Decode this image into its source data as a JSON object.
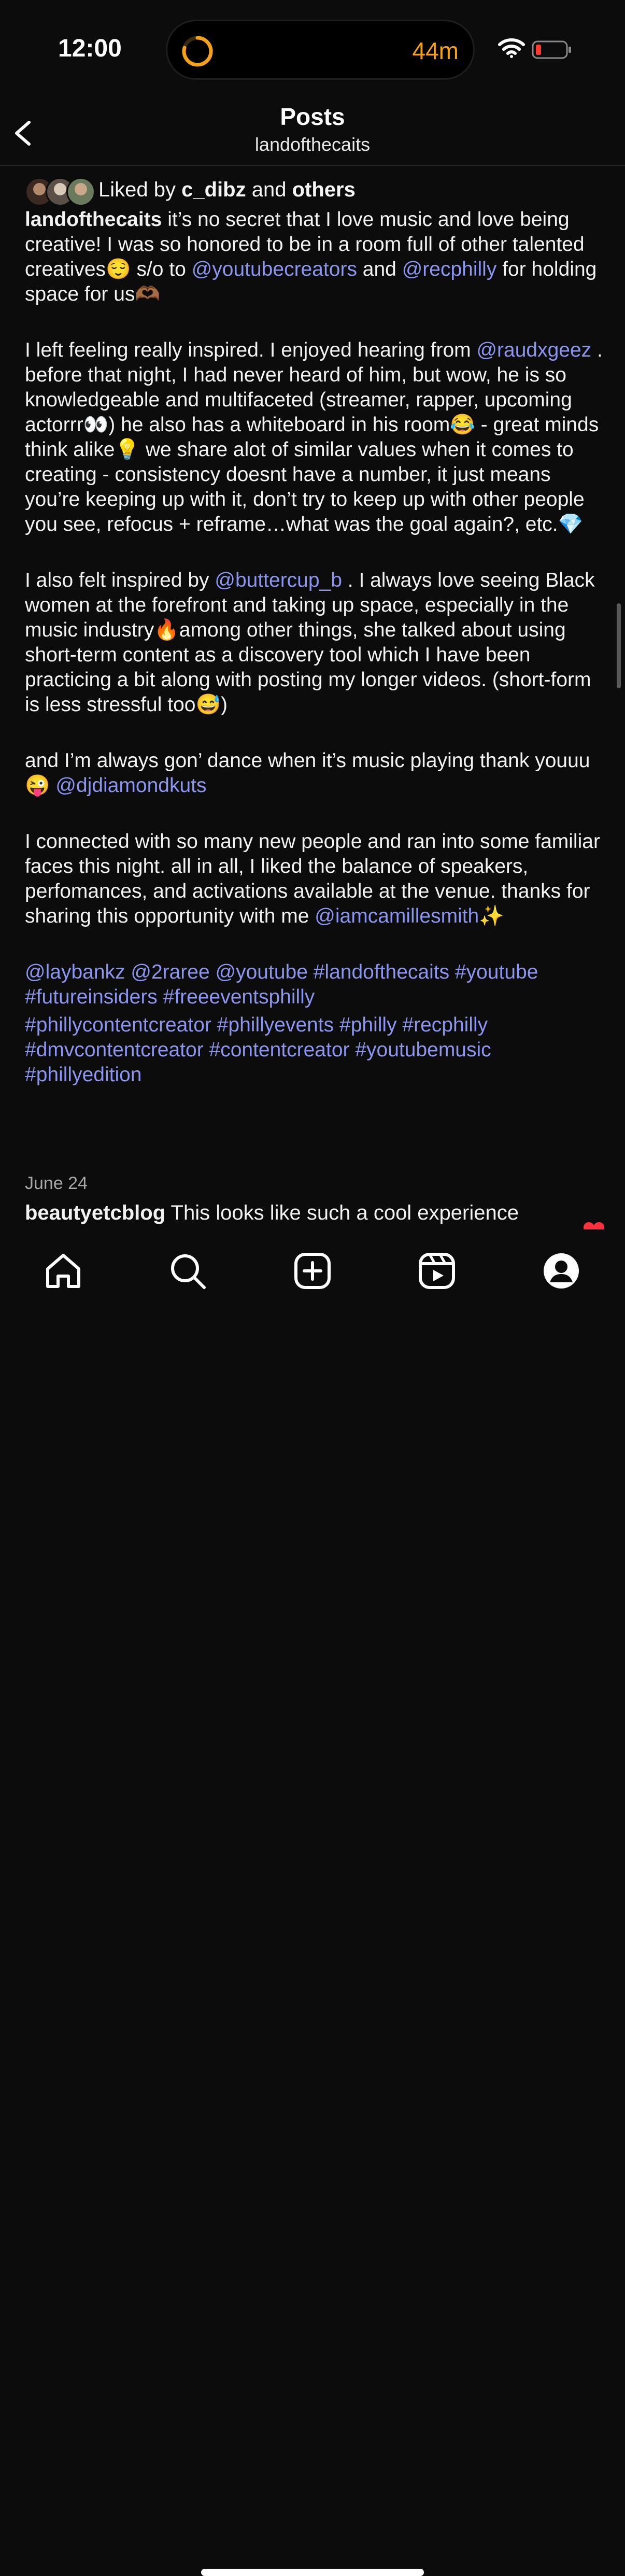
{
  "status_bar": {
    "time": "12:00",
    "timer": "44m",
    "timer_color": "#f5a11c"
  },
  "header": {
    "title": "Posts",
    "subtitle": "landofthecaits"
  },
  "likes": {
    "prefix": "Liked by ",
    "user": "c_dibz",
    "middle": " and ",
    "others": "others"
  },
  "post": {
    "username": "landofthecaits",
    "p1": {
      "text_a": " it’s no secret that I love music and love being creative! I was so honored to be in a room full of other talented creatives😌 s/o to ",
      "mention_a": "@youtubecreators",
      "text_b": " and ",
      "mention_b": "@recphilly",
      "text_c": " for holding space for us🫶🏾"
    },
    "p2": {
      "text_a": "I left feeling really inspired. I enjoyed hearing from ",
      "mention_a": "@raudxgeez",
      "text_b": " . before that night, I had never heard of him, but wow, he is so knowledgeable and multifaceted (streamer, rapper, upcoming actorrr👀) he also has a whiteboard in his room😂 - great minds think alike💡 we share alot of similar values when it comes to creating - consistency doesnt have a number, it just means you’re keeping up with it, don’t try to keep up with other people you see, refocus + reframe…what was the goal again?, etc.💎"
    },
    "p3": {
      "text_a": "I also felt inspired by ",
      "mention_a": "@buttercup_b",
      "text_b": " . I always love seeing Black women at the forefront and taking up space, especially in the music industry🔥among other things, she talked about using short-term content as a discovery tool which I have been practicing a bit along with posting my longer videos. (short-form is less stressful too😅)"
    },
    "p4": {
      "text_a": "and I’m always gon’ dance when it’s music playing thank youuu😜 ",
      "mention_a": "@djdiamondkuts"
    },
    "p5": {
      "text_a": "I connected with so many new people and ran into some familiar faces this night. all in all, I liked the balance of speakers, perfomances, and activations available at the venue. thanks for sharing this opportunity with me ",
      "mention_a": "@iamcamillesmith",
      "text_b": "✨"
    },
    "tags_line1": "@laybankz @2raree @youtube #landofthecaits #youtube #futureinsiders #freeeventsphilly",
    "tags_line2": "#phillycontentcreator #phillyevents #philly #recphilly #dmvcontentcreator #contentcreator #youtubemusic #phillyedition",
    "date": "June 24"
  },
  "comment": {
    "username": "beautyetcblog",
    "text": " This looks like such a cool experience"
  },
  "tabbar": {
    "tabs": [
      "home-icon",
      "search-icon",
      "create-icon",
      "reels-icon",
      "profile-icon"
    ]
  },
  "colors": {
    "link": "#8c95f0",
    "background": "#0c0c0c"
  }
}
